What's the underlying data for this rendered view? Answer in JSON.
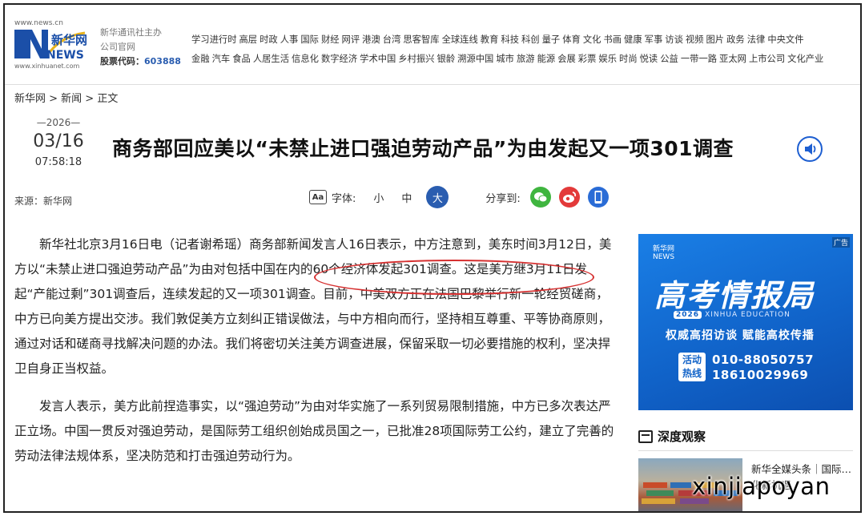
{
  "site": {
    "url_top": "www.news.cn",
    "logo_cn": "新华网",
    "logo_en": "NEWS",
    "url_bottom": "www.xinhuanet.com",
    "org_line1": "新华通讯社主办",
    "org_line2": "公司官网",
    "stock_label": "股票代码：",
    "stock_code": "603888"
  },
  "nav": {
    "row1": [
      "学习进行时",
      "高层",
      "时政",
      "人事",
      "国际",
      "财经",
      "网评",
      "港澳",
      "台湾",
      "思客智库",
      "全球连线",
      "教育",
      "科技",
      "科创",
      "量子",
      "体育",
      "文化",
      "书画",
      "健康",
      "军事",
      "访谈",
      "视频",
      "图片",
      "政务",
      "法律",
      "中央文件"
    ],
    "row2": [
      "金融",
      "汽车",
      "食品",
      "人居生活",
      "信息化",
      "数字经济",
      "学术中国",
      "乡村振兴",
      "银龄",
      "溯源中国",
      "城市",
      "旅游",
      "能源",
      "会展",
      "彩票",
      "娱乐",
      "时尚",
      "悦读",
      "公益",
      "一带一路",
      "亚太网",
      "上市公司",
      "文化产业"
    ]
  },
  "breadcrumb": "新华网 > 新闻 > 正文",
  "article": {
    "year": "2026",
    "month_day": "03/16",
    "time": "07:58:18",
    "source": "来源：新华网",
    "title": "商务部回应美以“未禁止进口强迫劳动产品”为由发起又一项301调查",
    "paragraphs": [
      "新华社北京3月16日电（记者谢希瑶）商务部新闻发言人16日表示，中方注意到，美东时间3月12日，美方以“未禁止进口强迫劳动产品”为由对包括中国在内的60个经济体发起301调查。这是美方继3月11日发起“产能过剩”301调查后，连续发起的又一项301调查。目前，中美双方正在法国巴黎举行新一轮经贸磋商，中方已向美方提出交涉。我们敦促美方立刻纠正错误做法，与中方相向而行，坚持相互尊重、平等协商原则，通过对话和磋商寻找解决问题的办法。我们将密切关注美方调查进展，保留采取一切必要措施的权利，坚决捍卫自身正当权益。",
      "发言人表示，美方此前捏造事实，以“强迫劳动”为由对华实施了一系列贸易限制措施，中方已多次表达严正立场。中国一贯反对强迫劳动，是国际劳工组织创始成员国之一，已批准28项国际劳工公约，建立了完善的劳动法律法规体系，坚决防范和打击强迫劳动行为。"
    ]
  },
  "tools": {
    "font_icon": "Aa",
    "font_label": "字体:",
    "size_small": "小",
    "size_medium": "中",
    "size_large": "大",
    "share_label": "分享到:"
  },
  "ad": {
    "tag": "广告",
    "logo_cn": "新华网",
    "logo_en": "NEWS",
    "headline": "高考情报局",
    "year_badge": "2026",
    "sub_en": "XINHUA EDUCATION",
    "slogan": "权威高招访谈  赋能高校传播",
    "hotline_label_1": "活动",
    "hotline_label_2": "热线",
    "phone1": "010-88050757",
    "phone2": "18610029969"
  },
  "sidebar": {
    "section_title": "深度观察",
    "item_text": "新华全媒头条｜国际…化新机遇"
  },
  "watermark": "xinjiapoyan",
  "colors": {
    "accent_blue": "#2a5db0",
    "highlight_red": "#d63030",
    "wechat_green": "#3fb53f",
    "weibo_red": "#e33a3a"
  }
}
